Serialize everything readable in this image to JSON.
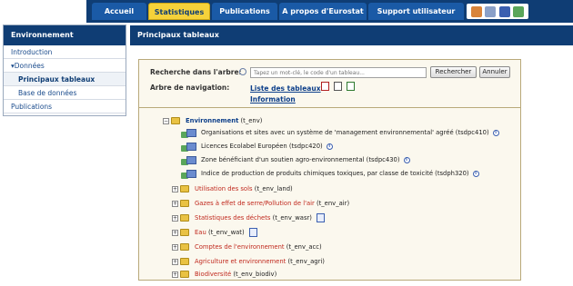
{
  "nav": {
    "tabs": [
      {
        "label": "Accueil"
      },
      {
        "label": "Statistiques"
      },
      {
        "label": "Publications"
      },
      {
        "label": "A propos d'Eurostat"
      },
      {
        "label": "Support utilisateur"
      }
    ],
    "active_tab": "Statistiques",
    "icons": [
      "user-icon",
      "search-icon",
      "calendar-icon",
      "database-icon"
    ]
  },
  "sidebar": {
    "title": "Environnement",
    "items": [
      {
        "label": "Introduction"
      },
      {
        "label": "▾Données"
      },
      {
        "label": "Principaux tableaux"
      },
      {
        "label": "Base de données"
      },
      {
        "label": "Publications"
      }
    ]
  },
  "main": {
    "title": "Principaux tableaux",
    "search": {
      "label": "Recherche dans l'arbre:",
      "placeholder": "Tapez un mot-clé, le code d'un tableau...",
      "search_button": "Rechercher",
      "cancel_button": "Annuler"
    },
    "nav_tree": {
      "label": "Arbre de navigation:",
      "list_link": "Liste des tableaux",
      "info_link": "Information"
    },
    "tree": {
      "root": {
        "title": "Environnement",
        "code": "(t_env)"
      },
      "datasets": [
        {
          "label": "Organisations et sites avec un système de 'management environnemental' agréé (tsdpc410)"
        },
        {
          "label": "Licences Ecolabel Européen (tsdpc420)"
        },
        {
          "label": "Zone bénéficiant d'un soutien agro-environnemental (tsdpc430)"
        },
        {
          "label": "Indice de production de produits chimiques toxiques, par classe de toxicité (tsdph320)"
        }
      ],
      "folders": [
        {
          "title": "Utilisation des sols",
          "code": "(t_env_land)"
        },
        {
          "title": "Gazes à effet de serre/Pollution de l'air",
          "code": "(t_env_air)"
        },
        {
          "title": "Statistiques des déchets",
          "code": "(t_env_wasr)"
        },
        {
          "title": "Eau",
          "code": "(t_env_wat)"
        },
        {
          "title": "Comptes de l'environnement",
          "code": "(t_env_acc)"
        },
        {
          "title": "Agriculture et environnement",
          "code": "(t_env_agri)"
        },
        {
          "title": "Biodiversité",
          "code": "(t_env_biodiv)"
        }
      ]
    }
  },
  "colors": {
    "nav_bg": "#0f3d74",
    "active_tab": "#f5d23a",
    "folder_text": "#c0281d",
    "link": "#0d3f8a"
  }
}
